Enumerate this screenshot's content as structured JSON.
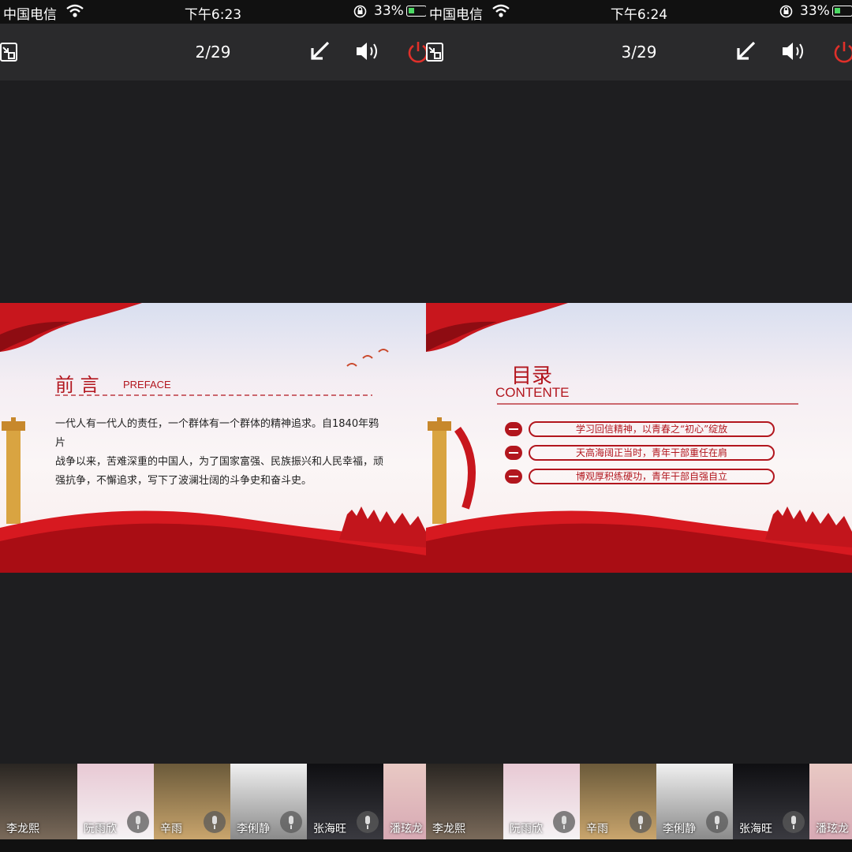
{
  "colors": {
    "accent_red": "#b2161e",
    "background": "#1e1e20",
    "battery_green": "#4cd964"
  },
  "panels": [
    {
      "status": {
        "carrier": "中国电信",
        "time": "下午6:23",
        "battery": "33%"
      },
      "toolbar": {
        "page": "2/29",
        "icons": [
          "exit-fullscreen-icon",
          "arrow-icon",
          "speaker-icon",
          "power-icon"
        ]
      },
      "slide": {
        "title": "前  言",
        "subtitle": "PREFACE",
        "body_lines": [
          "一代人有一代人的责任，一个群体有一个群体的精神追求。自1840年鸦片",
          "战争以来，苦难深重的中国人，为了国家富强、民族振兴和人民幸福，顽",
          "强抗争，不懈追求，写下了波澜壮阔的斗争史和奋斗史。"
        ]
      },
      "participants": [
        "李龙熙",
        "阮雨欣",
        "辛雨",
        "李俐静",
        "张海旺",
        "潘玹龙"
      ]
    },
    {
      "status": {
        "carrier": "中国电信",
        "time": "下午6:24",
        "battery": "33%"
      },
      "toolbar": {
        "page": "3/29",
        "icons": [
          "exit-fullscreen-icon",
          "arrow-icon",
          "speaker-icon",
          "power-icon"
        ]
      },
      "slide": {
        "title": "目录",
        "subtitle": "CONTENTE",
        "toc": [
          {
            "label": "学习回信精神，以青春之“初心”绽放"
          },
          {
            "label": "天高海阔正当时，青年干部重任在肩"
          },
          {
            "label": "博观厚积练硬功，青年干部自强自立"
          }
        ]
      },
      "participants": [
        "李龙熙",
        "阮雨欣",
        "辛雨",
        "李俐静",
        "张海旺",
        "潘玹龙"
      ]
    }
  ]
}
